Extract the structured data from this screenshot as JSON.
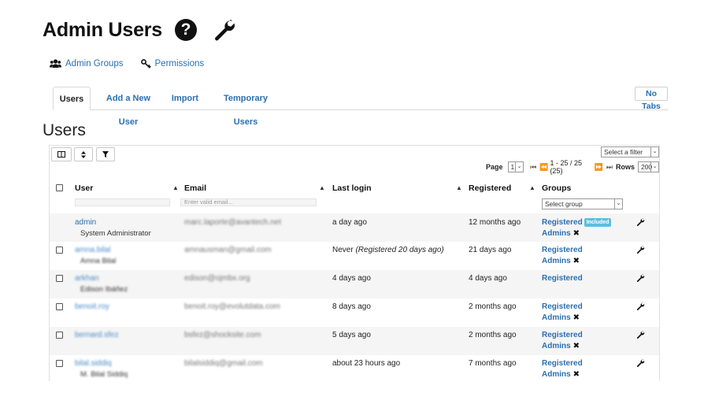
{
  "header": {
    "title": "Admin Users",
    "help_glyph": "?"
  },
  "subnav": [
    {
      "label": "Admin Groups",
      "icon": "users-icon"
    },
    {
      "label": "Permissions",
      "icon": "key-icon"
    }
  ],
  "tabs": [
    {
      "label": "Users",
      "active": true
    },
    {
      "label": "Add a New User",
      "active": false
    },
    {
      "label": "Import",
      "active": false
    },
    {
      "label": "Temporary Users",
      "active": false
    }
  ],
  "no_tabs_label": "No Tabs",
  "section_title": "Users",
  "grid": {
    "filter_select": "Select a filter",
    "pager": {
      "page_label": "Page",
      "page_value": "1",
      "range": "1 - 25 / 25 (25)",
      "rows_label": "Rows",
      "rows_value": "200"
    },
    "columns": [
      "User",
      "Email",
      "Last login",
      "Registered",
      "Groups"
    ],
    "email_placeholder": "Enter valid email...",
    "group_placeholder": "Select group",
    "included_badge": "Included",
    "rows": [
      {
        "username": "admin",
        "fullname": "System Administrator",
        "email": "marc.laporte@avantech.net",
        "last_login": "a day ago",
        "last_login_note": "",
        "registered": "12 months ago",
        "groups": [
          "Registered",
          "Admins"
        ]
      },
      {
        "username": "amna.bilal",
        "fullname": "Amna Bilal",
        "email": "amnausman@gmail.com",
        "last_login": "Never",
        "last_login_note": "(Registered 20 days ago)",
        "registered": "21 days ago",
        "groups": [
          "Registered",
          "Admins"
        ]
      },
      {
        "username": "arkhan",
        "fullname": "Edison Ibáñez",
        "email": "edison@ojmbx.org",
        "last_login": "4 days ago",
        "last_login_note": "",
        "registered": "4 days ago",
        "groups": [
          "Registered"
        ]
      },
      {
        "username": "benoit.roy",
        "fullname": "",
        "email": "benoit.roy@evolutdata.com",
        "last_login": "8 days ago",
        "last_login_note": "",
        "registered": "2 months ago",
        "groups": [
          "Registered",
          "Admins"
        ]
      },
      {
        "username": "bernard.sfez",
        "fullname": "",
        "email": "bsfez@shocksite.com",
        "last_login": "5 days ago",
        "last_login_note": "",
        "registered": "2 months ago",
        "groups": [
          "Registered",
          "Admins"
        ]
      },
      {
        "username": "bilal.siddiq",
        "fullname": "M. Bilal Siddiq",
        "email": "bilalsiddiq@gmail.com",
        "last_login": "about 23 hours ago",
        "last_login_note": "",
        "registered": "7 months ago",
        "groups": [
          "Registered",
          "Admins"
        ]
      }
    ]
  }
}
